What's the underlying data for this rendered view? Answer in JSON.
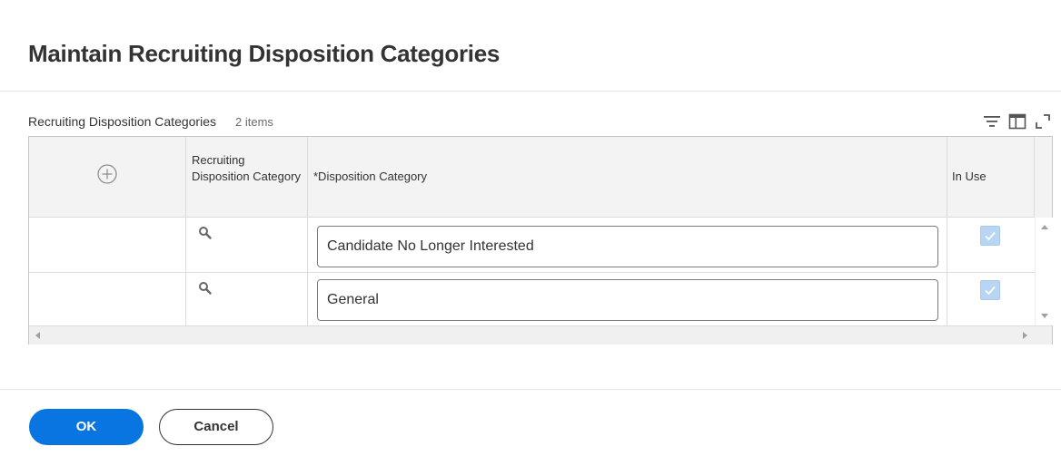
{
  "page": {
    "title": "Maintain Recruiting Disposition Categories"
  },
  "grid": {
    "title": "Recruiting Disposition Categories",
    "count": "2 items",
    "toolbar_icons": [
      "filter-icon",
      "columns-icon",
      "expand-icon"
    ],
    "columns": [
      {
        "key": "add",
        "label": ""
      },
      {
        "key": "category_ref",
        "label": "Recruiting Disposition Category"
      },
      {
        "key": "disposition_category",
        "label": "*Disposition Category"
      },
      {
        "key": "in_use",
        "label": "In Use"
      }
    ],
    "rows": [
      {
        "disposition_category": "Candidate No Longer Interested",
        "in_use": true
      },
      {
        "disposition_category": "General",
        "in_use": true
      }
    ]
  },
  "footer": {
    "ok_label": "OK",
    "cancel_label": "Cancel"
  },
  "colors": {
    "primary": "#0875e1",
    "checkbox_disabled": "#b8d5f3",
    "header_bg": "#f3f3f3"
  }
}
